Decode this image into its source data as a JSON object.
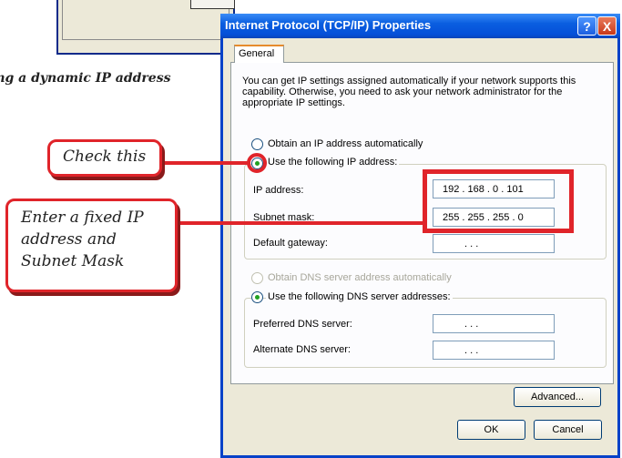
{
  "background_fragment": {
    "caption": "ing a dynamic IP address"
  },
  "dialog": {
    "title": "Internet Protocol (TCP/IP) Properties",
    "help_button": "?",
    "close_button": "X",
    "tab": "General",
    "description": "You can get IP settings assigned automatically if your network supports this capability. Otherwise, you need to ask your network administrator for the appropriate IP settings.",
    "ip_options": {
      "auto": "Obtain an IP address automatically",
      "manual": "Use the following IP address:",
      "selected": "manual"
    },
    "fields": {
      "ip_address_label": "IP address:",
      "ip_address_value": "192 . 168 .  0  . 101",
      "subnet_label": "Subnet mask:",
      "subnet_value": "255 . 255 . 255 .  0",
      "gateway_label": "Default gateway:",
      "gateway_value": ".       .       ."
    },
    "dns_options": {
      "auto": "Obtain DNS server address automatically",
      "manual": "Use the following DNS server addresses:",
      "selected": "manual"
    },
    "dns_fields": {
      "preferred_label": "Preferred DNS server:",
      "preferred_value": ".       .       .",
      "alternate_label": "Alternate DNS server:",
      "alternate_value": ".       .       ."
    },
    "advanced_button": "Advanced...",
    "ok_button": "OK",
    "cancel_button": "Cancel"
  },
  "annotations": {
    "check_this": "Check this",
    "enter_fixed": "Enter a fixed IP address and Subnet Mask",
    "color": "#e0242a"
  }
}
